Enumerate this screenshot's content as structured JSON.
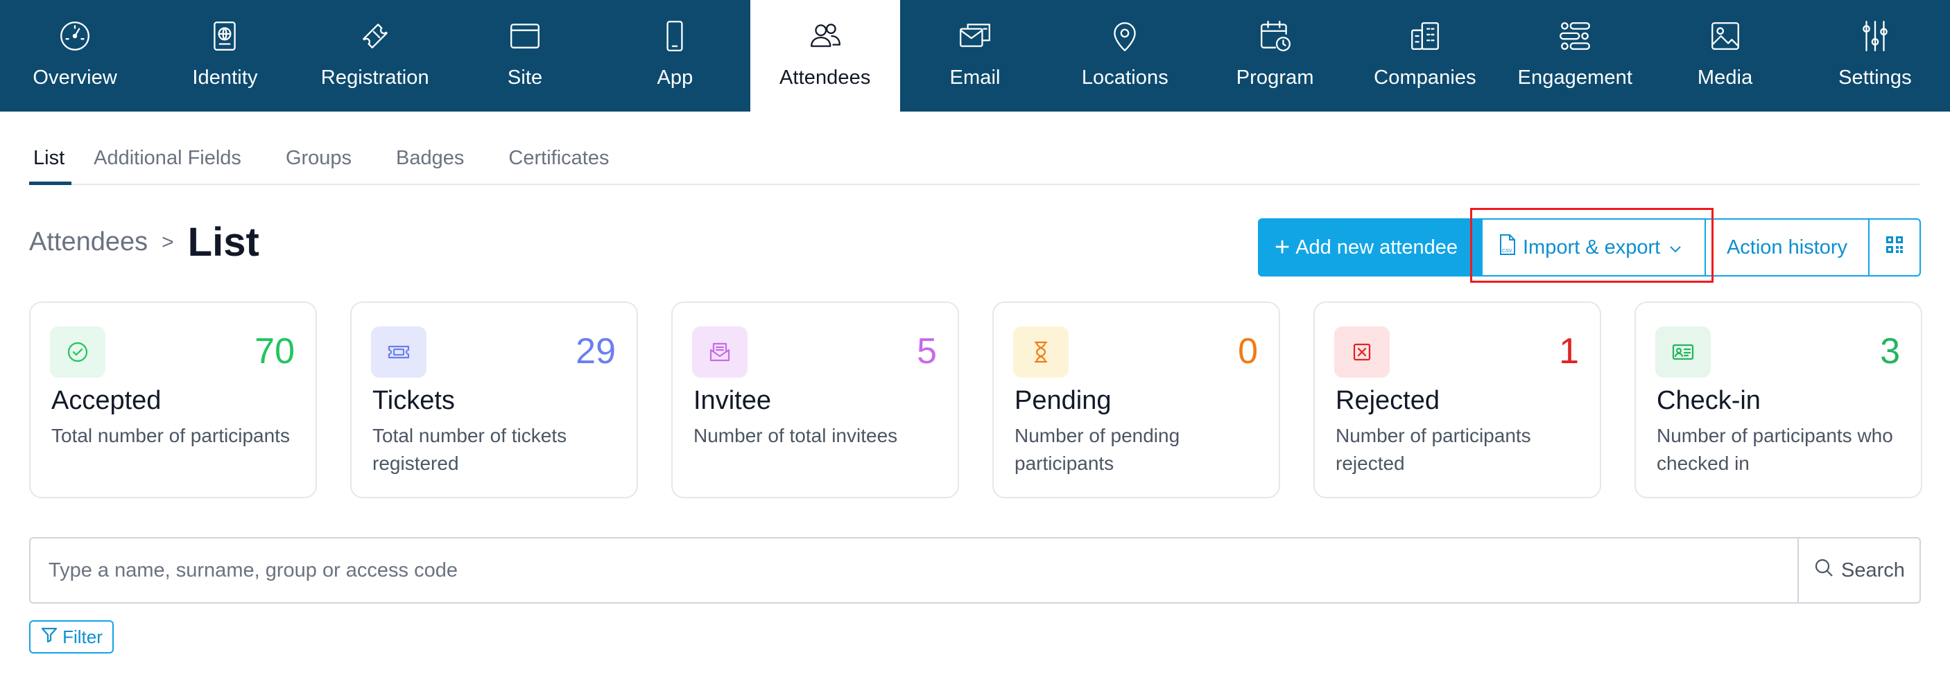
{
  "topnav": {
    "items": [
      {
        "label": "Overview",
        "icon": "gauge-icon",
        "active": false
      },
      {
        "label": "Identity",
        "icon": "passport-icon",
        "active": false
      },
      {
        "label": "Registration",
        "icon": "ticket-icon",
        "active": false
      },
      {
        "label": "Site",
        "icon": "browser-window-icon",
        "active": false
      },
      {
        "label": "App",
        "icon": "smartphone-icon",
        "active": false
      },
      {
        "label": "Attendees",
        "icon": "users-icon",
        "active": true
      },
      {
        "label": "Email",
        "icon": "email-icon",
        "active": false
      },
      {
        "label": "Locations",
        "icon": "map-pin-icon",
        "active": false
      },
      {
        "label": "Program",
        "icon": "calendar-clock-icon",
        "active": false
      },
      {
        "label": "Companies",
        "icon": "buildings-icon",
        "active": false
      },
      {
        "label": "Engagement",
        "icon": "engagement-icon",
        "active": false
      },
      {
        "label": "Media",
        "icon": "image-icon",
        "active": false
      },
      {
        "label": "Settings",
        "icon": "sliders-icon",
        "active": false
      }
    ]
  },
  "subtabs": [
    {
      "label": "List",
      "active": true
    },
    {
      "label": "Additional Fields",
      "active": false
    },
    {
      "label": "Groups",
      "active": false
    },
    {
      "label": "Badges",
      "active": false
    },
    {
      "label": "Certificates",
      "active": false
    }
  ],
  "breadcrumb": {
    "parent": "Attendees",
    "separator": ">",
    "current": "List"
  },
  "actions": {
    "add_label": "Add new attendee",
    "import_label": "Import & export",
    "history_label": "Action history"
  },
  "cards": [
    {
      "title": "Accepted",
      "count": "70",
      "description": "Total number of participants",
      "icon": "check-circle-icon",
      "color": "#22c55e",
      "bg": "#e7f8ee"
    },
    {
      "title": "Tickets",
      "count": "29",
      "description": "Total number of tickets registered",
      "icon": "ticket-icon",
      "color": "#6b7ff0",
      "bg": "#e5e8fc"
    },
    {
      "title": "Invitee",
      "count": "5",
      "description": "Number of total invitees",
      "icon": "envelope-open-icon",
      "color": "#c56ce8",
      "bg": "#f5e3fc"
    },
    {
      "title": "Pending",
      "count": "0",
      "description": "Number of pending participants",
      "icon": "hourglass-icon",
      "color": "#f07c14",
      "bg": "#fdf4d8"
    },
    {
      "title": "Rejected",
      "count": "1",
      "description": "Number of participants rejected",
      "icon": "x-square-icon",
      "color": "#e02424",
      "bg": "#fde3e3"
    },
    {
      "title": "Check-in",
      "count": "3",
      "description": "Number of participants who checked in",
      "icon": "id-card-icon",
      "color": "#22b55e",
      "bg": "#e6f6ec"
    }
  ],
  "search": {
    "placeholder": "Type a name, surname, group or access code",
    "value": "",
    "button_label": "Search"
  },
  "filter": {
    "label": "Filter"
  },
  "colors": {
    "nav_bg": "#0d4a6e",
    "accent": "#12a5e6",
    "highlight": "#ef1c1c"
  }
}
